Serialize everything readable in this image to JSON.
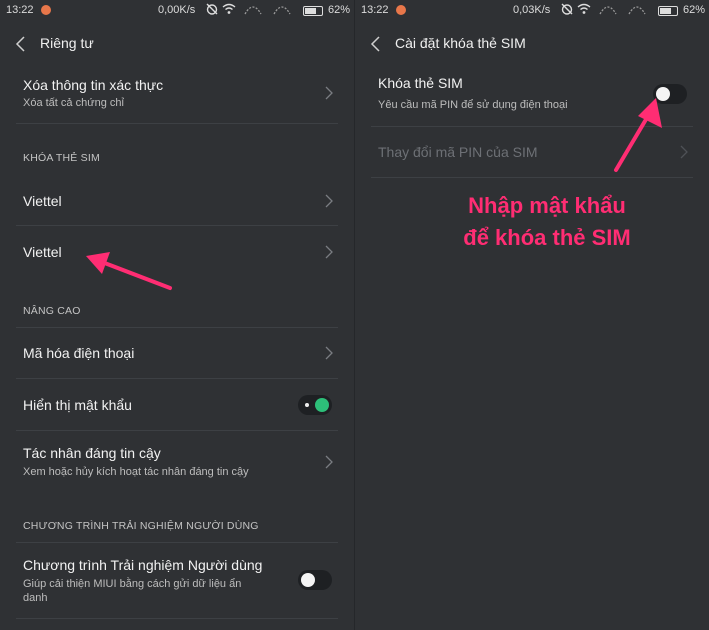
{
  "colors": {
    "background": "#2f3134",
    "accent_green": "#2dbf79",
    "annotation_pink": "#ff2d73"
  },
  "left": {
    "status": {
      "time": "13:22",
      "speed": "0,00K/s",
      "battery": "62%"
    },
    "title": "Riêng tư",
    "rows": [
      {
        "title": "Xóa thông tin xác thực",
        "subtitle": "Xóa tất cả chứng chỉ"
      },
      {
        "section": "KHÓA THẺ SIM"
      },
      {
        "title": "Viettel"
      },
      {
        "title": "Viettel"
      },
      {
        "section": "NÂNG CAO"
      },
      {
        "title": "Mã hóa điện thoại"
      },
      {
        "title": "Hiển thị mật khẩu",
        "toggle": "on"
      },
      {
        "title": "Tác nhân đáng tin cậy",
        "subtitle": "Xem hoặc hủy kích hoạt tác nhân đáng tin cậy"
      },
      {
        "section": "CHƯƠNG TRÌNH TRẢI NGHIỆM NGƯỜI DÙNG"
      },
      {
        "title": "Chương trình Trải nghiệm Người dùng",
        "subtitle_line1": "Giúp cải thiện MIUI bằng cách gửi dữ liệu ẩn",
        "subtitle_line2": "danh",
        "toggle": "off"
      }
    ]
  },
  "right": {
    "status": {
      "time": "13:22",
      "speed": "0,03K/s",
      "battery": "62%"
    },
    "title": "Cài đặt khóa thẻ SIM",
    "rows": [
      {
        "title": "Khóa thẻ SIM",
        "subtitle": "Yêu cầu mã PIN để sử dụng điện thoại",
        "toggle": "off"
      },
      {
        "title": "Thay đổi mã PIN của SIM",
        "disabled": true
      }
    ],
    "annotation": {
      "line1": "Nhập mật khẩu",
      "line2": "để khóa thẻ SIM"
    }
  }
}
